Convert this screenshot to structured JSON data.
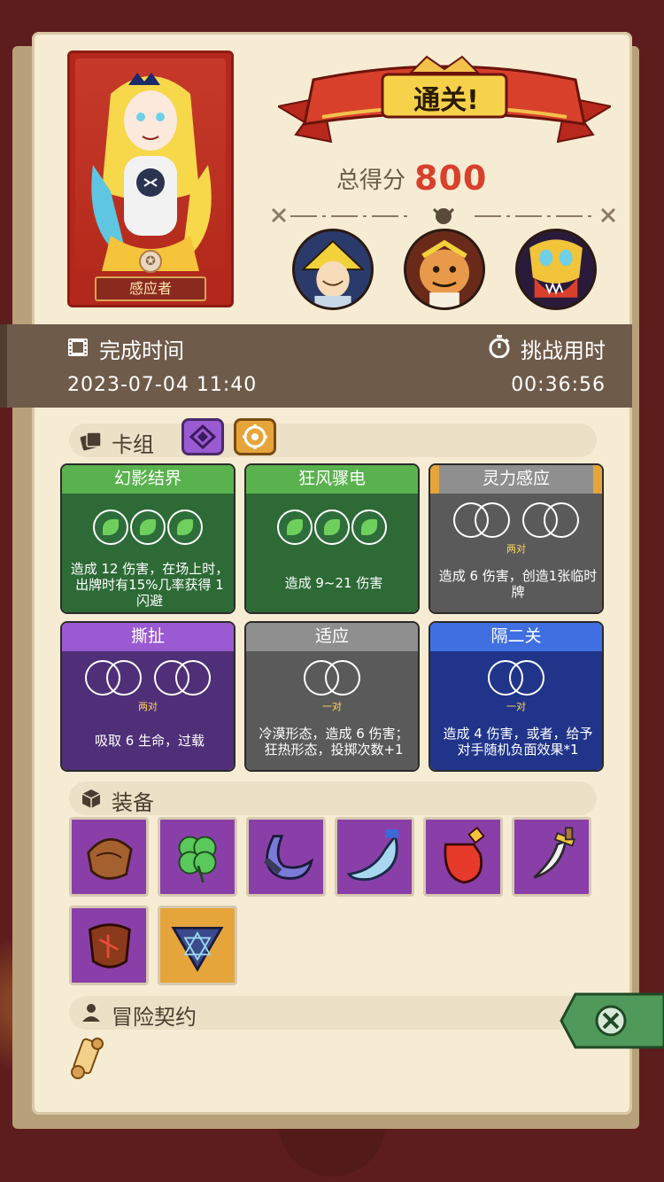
{
  "hero": {
    "name": "感应者"
  },
  "banner": {
    "title": "通关!"
  },
  "score": {
    "label": "总得分",
    "value": "800"
  },
  "time": {
    "finish_label": "完成时间",
    "challenge_label": "挑战用时",
    "finish_value": "2023-07-04 11:40",
    "challenge_value": "00:36:56"
  },
  "deck": {
    "label": "卡组",
    "cards": [
      {
        "title": "幻影结界",
        "desc": "造成 12 伤害，在场上时，出牌时有15%几率获得 1 闪避"
      },
      {
        "title": "狂风骤电",
        "desc": "造成 9~21 伤害"
      },
      {
        "title": "灵力感应",
        "pair_note": "两对",
        "desc": "造成 6 伤害，创造1张临时牌"
      },
      {
        "title": "撕扯",
        "pair_note": "两对",
        "desc": "吸取 6 生命，过载"
      },
      {
        "title": "适应",
        "pair_note": "一对",
        "desc": "冷漠形态，造成 6 伤害；狂热形态，投掷次数+1"
      },
      {
        "title": "隔二关",
        "pair_note": "一对",
        "desc": "造成 4 伤害，或者，给予对手随机负面效果*1"
      }
    ]
  },
  "equipment": {
    "label": "装备"
  },
  "contract": {
    "label": "冒险契约"
  },
  "icons": {
    "film": "film-icon",
    "timer": "stopwatch-icon",
    "cards": "cards-icon",
    "cube": "cube-icon",
    "person": "person-icon",
    "close": "close-icon"
  },
  "colors": {
    "score": "#d8402c",
    "banner": "#c0392b",
    "green_card": "#2d6a36",
    "gray_card": "#5a5a5a",
    "purple_card": "#4f2f78",
    "blue_card": "#20358a",
    "paper": "#f6ecd4"
  }
}
